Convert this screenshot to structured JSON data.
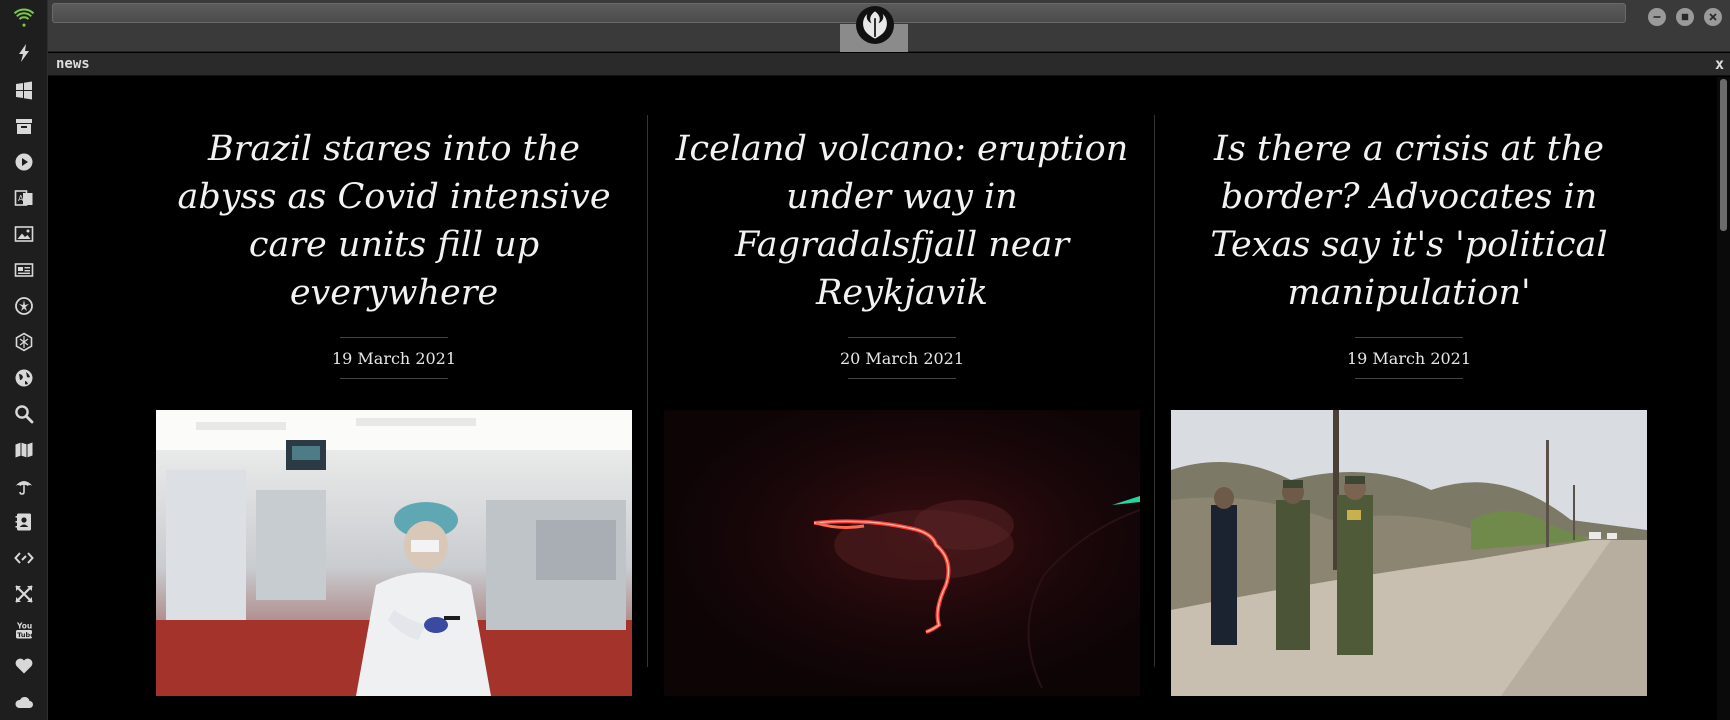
{
  "dock": {
    "items": [
      {
        "name": "wifi-icon"
      },
      {
        "name": "lightning-icon"
      },
      {
        "name": "windows-icon"
      },
      {
        "name": "archive-icon"
      },
      {
        "name": "play-circle-icon"
      },
      {
        "name": "translate-icon"
      },
      {
        "name": "image-icon"
      },
      {
        "name": "newspaper-icon"
      },
      {
        "name": "jedi-order-icon"
      },
      {
        "name": "hexagon-network-icon"
      },
      {
        "name": "globe-icon"
      },
      {
        "name": "search-icon"
      },
      {
        "name": "map-icon"
      },
      {
        "name": "umbrella-icon"
      },
      {
        "name": "address-book-icon"
      },
      {
        "name": "code-link-icon"
      },
      {
        "name": "expand-arrows-icon"
      },
      {
        "name": "youtube-icon"
      },
      {
        "name": "heart-icon"
      },
      {
        "name": "cloud-icon"
      }
    ]
  },
  "panel": {
    "title": "news",
    "close_label": "x"
  },
  "articles": [
    {
      "headline": "Brazil stares into the abyss as Covid intensive care units fill up everywhere",
      "date": "19 March 2021"
    },
    {
      "headline": "Iceland volcano: eruption under way in Fagradalsfjall near Reykjavik",
      "date": "20 March 2021"
    },
    {
      "headline": "Is there a crisis at the border? Advocates in Texas say it's 'political manipulation'",
      "date": "19 March 2021"
    }
  ],
  "colors": {
    "accent_wifi": "#7ac943",
    "background": "#000000",
    "dock": "#1e1e1e"
  }
}
